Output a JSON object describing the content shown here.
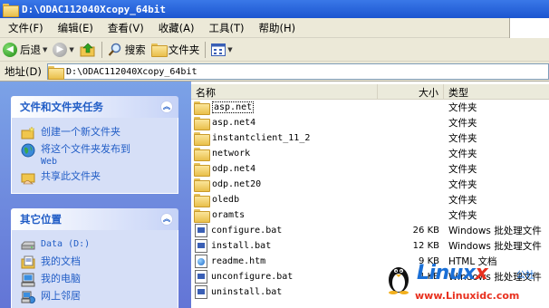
{
  "window": {
    "title": "D:\\ODAC112040Xcopy_64bit"
  },
  "menu": [
    "文件(F)",
    "编辑(E)",
    "查看(V)",
    "收藏(A)",
    "工具(T)",
    "帮助(H)"
  ],
  "toolbar": {
    "back": "后退",
    "search": "搜索",
    "folders": "文件夹"
  },
  "address": {
    "label": "地址(D)",
    "value": "D:\\ODAC112040Xcopy_64bit"
  },
  "tasks_panel": {
    "title": "文件和文件夹任务",
    "items": [
      "创建一个新文件夹",
      "将这个文件夹发布到",
      "Web",
      "共享此文件夹"
    ]
  },
  "places_panel": {
    "title": "其它位置",
    "items": [
      "Data (D:)",
      "我的文档",
      "我的电脑",
      "网上邻居"
    ]
  },
  "columns": {
    "name": "名称",
    "size": "大小",
    "type": "类型"
  },
  "files": [
    {
      "name": "asp.net",
      "size": "",
      "type": "文件夹",
      "icon": "folder-icon"
    },
    {
      "name": "asp.net4",
      "size": "",
      "type": "文件夹",
      "icon": "folder-icon"
    },
    {
      "name": "instantclient_11_2",
      "size": "",
      "type": "文件夹",
      "icon": "folder-icon"
    },
    {
      "name": "network",
      "size": "",
      "type": "文件夹",
      "icon": "folder-icon"
    },
    {
      "name": "odp.net4",
      "size": "",
      "type": "文件夹",
      "icon": "folder-icon"
    },
    {
      "name": "odp.net20",
      "size": "",
      "type": "文件夹",
      "icon": "folder-icon"
    },
    {
      "name": "oledb",
      "size": "",
      "type": "文件夹",
      "icon": "folder-icon"
    },
    {
      "name": "oramts",
      "size": "",
      "type": "文件夹",
      "icon": "folder-icon"
    },
    {
      "name": "configure.bat",
      "size": "26 KB",
      "type": "Windows 批处理文件",
      "icon": "batch-file-icon"
    },
    {
      "name": "install.bat",
      "size": "12 KB",
      "type": "Windows 批处理文件",
      "icon": "batch-file-icon"
    },
    {
      "name": "readme.htm",
      "size": "9 KB",
      "type": "HTML 文档",
      "icon": "html-file-icon"
    },
    {
      "name": "unconfigure.bat",
      "size": "4 KB",
      "type": "Windows 批处理文件",
      "icon": "batch-file-icon"
    },
    {
      "name": "uninstall.bat",
      "size": "",
      "type": "",
      "icon": "batch-file-icon"
    }
  ],
  "watermark": {
    "brand_a": "Linux",
    "brand_b": "x",
    "brand_cn": "公社",
    "url": "www.Linuxidc.com"
  }
}
